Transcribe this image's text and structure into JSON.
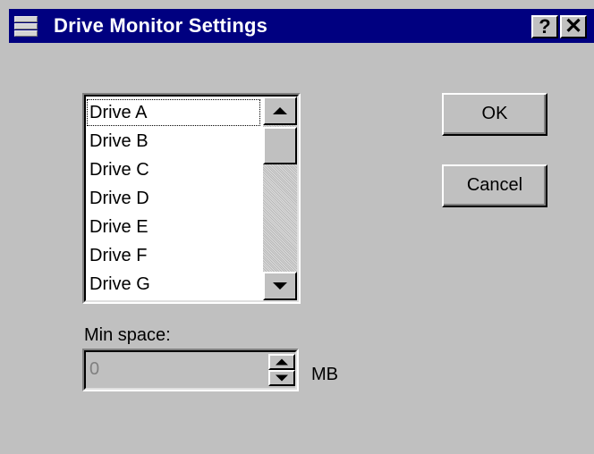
{
  "window": {
    "title": "Drive Monitor Settings",
    "help_label": "?",
    "close_label": "✕"
  },
  "drive_list": {
    "items": [
      "Drive A",
      "Drive B",
      "Drive C",
      "Drive D",
      "Drive E",
      "Drive F",
      "Drive G"
    ],
    "focused_item": "Drive A"
  },
  "buttons": {
    "ok_label": "OK",
    "cancel_label": "Cancel"
  },
  "min_space": {
    "label": "Min space:",
    "value": "0",
    "unit": "MB"
  },
  "icons": {
    "app": "drive-stack-icon",
    "scroll_up": "scroll-up-arrow-icon",
    "scroll_down": "scroll-down-arrow-icon",
    "spin_up": "spin-up-arrow-icon",
    "spin_down": "spin-down-arrow-icon"
  }
}
